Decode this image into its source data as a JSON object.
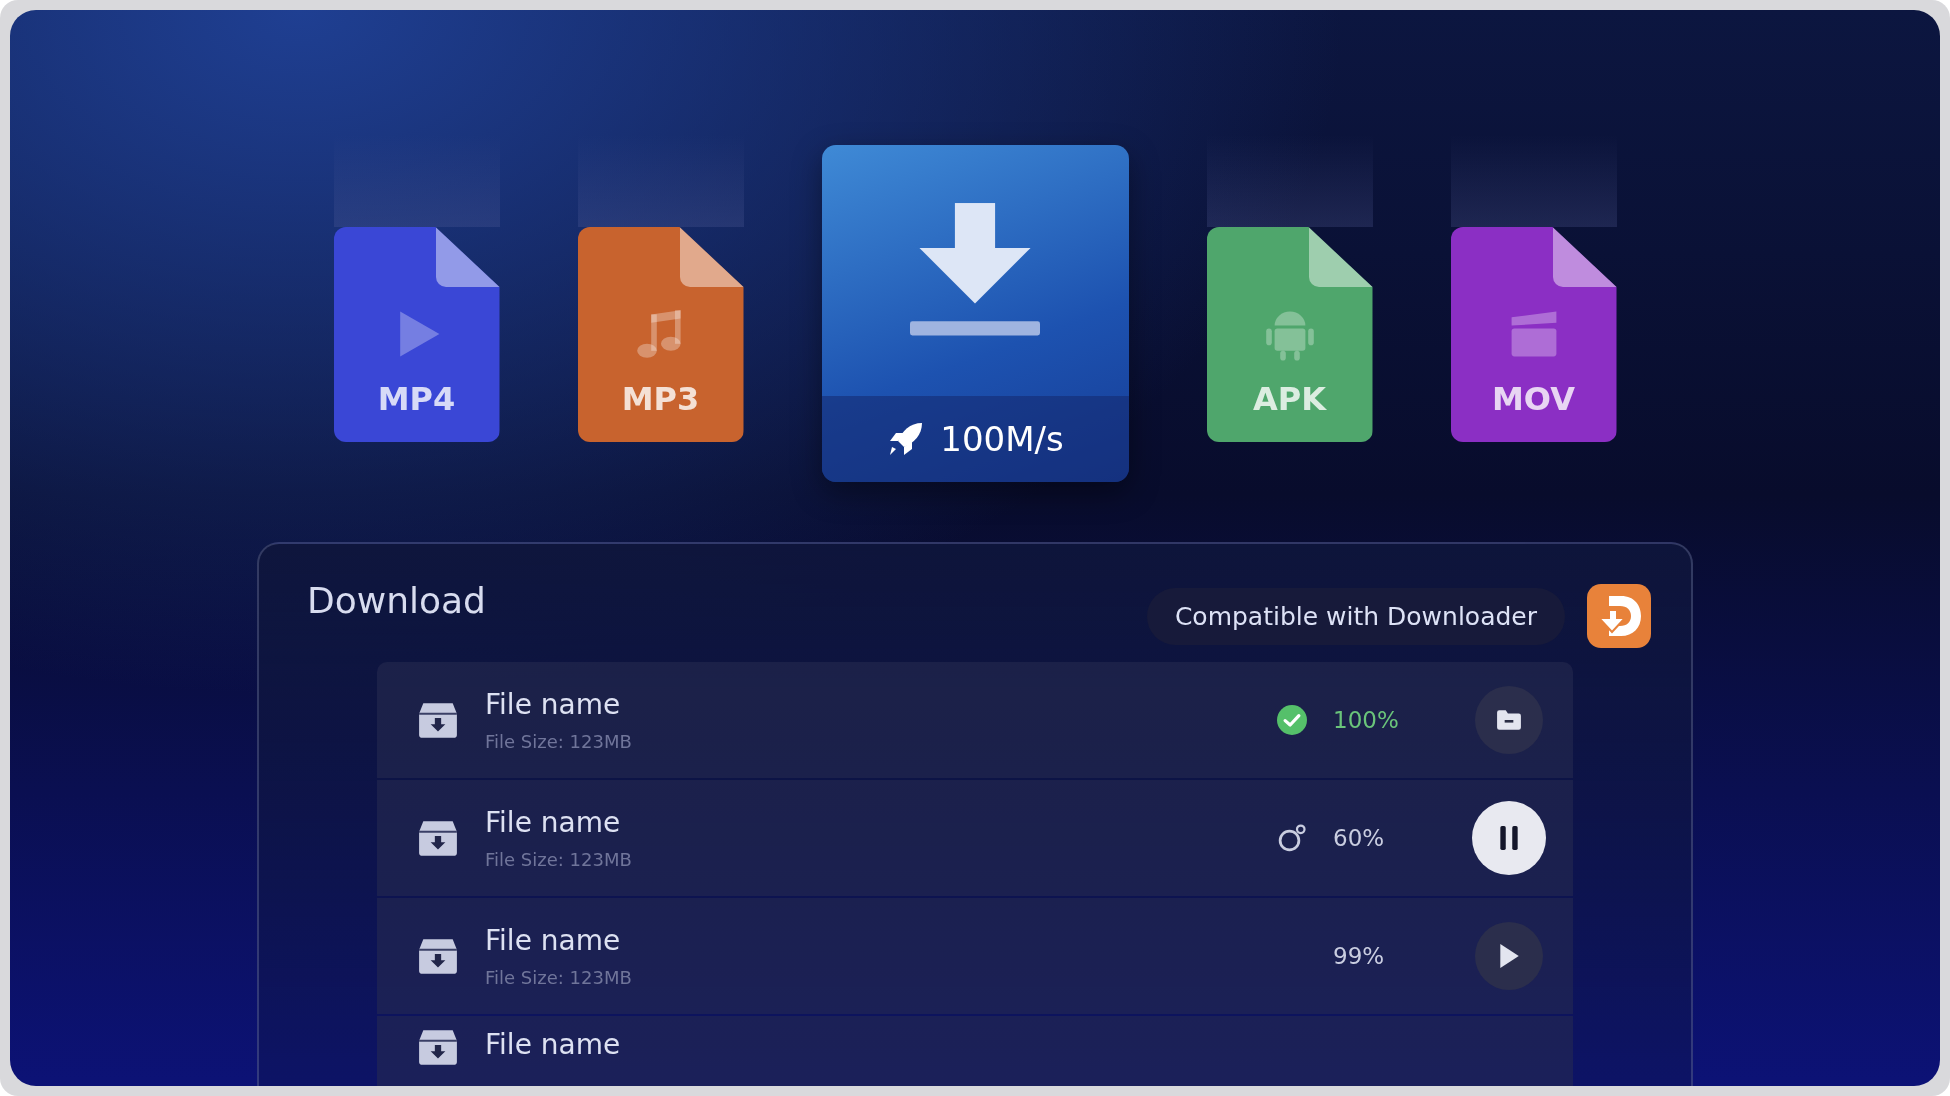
{
  "formats": [
    {
      "label": "MP4",
      "kind": "video",
      "color": "#3a47d6"
    },
    {
      "label": "MP3",
      "kind": "audio",
      "color": "#c8632e"
    },
    {
      "label": "APK",
      "kind": "android",
      "color": "#4fa66c"
    },
    {
      "label": "MOV",
      "kind": "movie",
      "color": "#8b2fc4"
    }
  ],
  "speed": {
    "label": "100M/s"
  },
  "panel": {
    "title": "Download",
    "compat": "Compatible with Downloader"
  },
  "files": [
    {
      "name": "File name",
      "size": "File Size: 123MB",
      "percent": "100%",
      "kind": "done"
    },
    {
      "name": "File name",
      "size": "File Size: 123MB",
      "percent": "60%",
      "kind": "downloading"
    },
    {
      "name": "File name",
      "size": "File Size: 123MB",
      "percent": "99%",
      "kind": "paused"
    },
    {
      "name": "File name",
      "kind": "partial"
    }
  ]
}
